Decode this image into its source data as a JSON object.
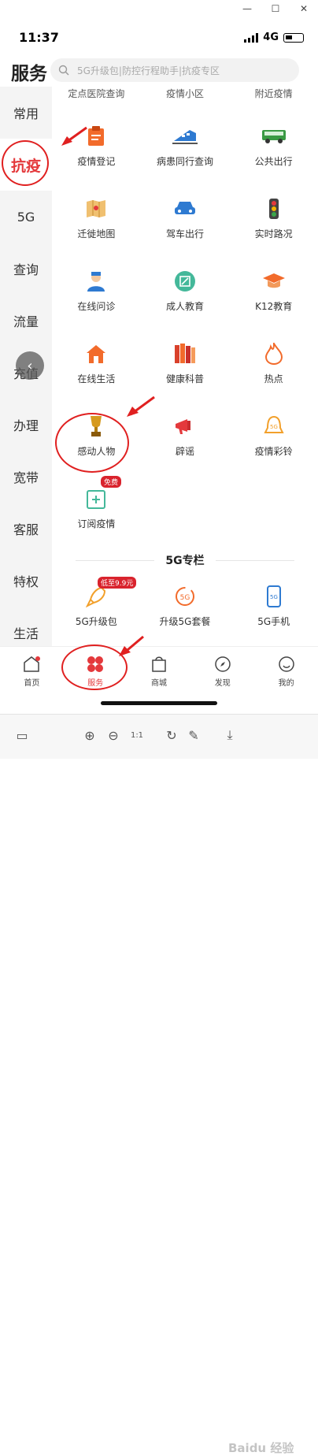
{
  "window": {
    "minimize": "—",
    "maximize": "☐",
    "close": "✕"
  },
  "status": {
    "time": "11:37",
    "network": "4G"
  },
  "header": {
    "title": "服务",
    "search_placeholder": "5G升级包|防控行程助手|抗疫专区"
  },
  "sidebar": {
    "items": [
      {
        "label": "常用"
      },
      {
        "label": "抗疫"
      },
      {
        "label": "5G"
      },
      {
        "label": "查询"
      },
      {
        "label": "流量"
      },
      {
        "label": "充值"
      },
      {
        "label": "办理"
      },
      {
        "label": "宽带"
      },
      {
        "label": "客服"
      },
      {
        "label": "特权"
      },
      {
        "label": "生活"
      }
    ]
  },
  "top_row": [
    "定点医院查询",
    "疫情小区",
    "附近疫情"
  ],
  "services": [
    {
      "label": "疫情登记",
      "icon": "clipboard-icon"
    },
    {
      "label": "病患同行查询",
      "icon": "train-icon"
    },
    {
      "label": "公共出行",
      "icon": "bus-icon"
    },
    {
      "label": "迁徙地图",
      "icon": "map-icon"
    },
    {
      "label": "驾车出行",
      "icon": "car-icon"
    },
    {
      "label": "实时路况",
      "icon": "traffic-light-icon"
    },
    {
      "label": "在线问诊",
      "icon": "doctor-icon"
    },
    {
      "label": "成人教育",
      "icon": "education-icon"
    },
    {
      "label": "K12教育",
      "icon": "graduation-cap-icon"
    },
    {
      "label": "在线生活",
      "icon": "house-icon"
    },
    {
      "label": "健康科普",
      "icon": "books-icon"
    },
    {
      "label": "热点",
      "icon": "flame-icon"
    },
    {
      "label": "感动人物",
      "icon": "trophy-icon"
    },
    {
      "label": "辟谣",
      "icon": "megaphone-icon"
    },
    {
      "label": "疫情彩铃",
      "icon": "bell-icon"
    },
    {
      "label": "订阅疫情",
      "icon": "subscribe-icon",
      "badge": "免费"
    }
  ],
  "section_5g": {
    "title": "5G专栏",
    "items": [
      {
        "label": "5G升级包",
        "badge": "低至9.9元",
        "icon": "rocket-icon"
      },
      {
        "label": "升级5G套餐",
        "icon": "5g-circle-icon"
      },
      {
        "label": "5G手机",
        "icon": "phone-icon"
      }
    ]
  },
  "tabbar": [
    {
      "label": "首页"
    },
    {
      "label": "服务"
    },
    {
      "label": "商城"
    },
    {
      "label": "发现"
    },
    {
      "label": "我的"
    }
  ],
  "watermark": "Baidu 经验",
  "colors": {
    "accent": "#e4393c",
    "icon_orange": "#f26b2b",
    "annotation_red": "#e02020"
  }
}
